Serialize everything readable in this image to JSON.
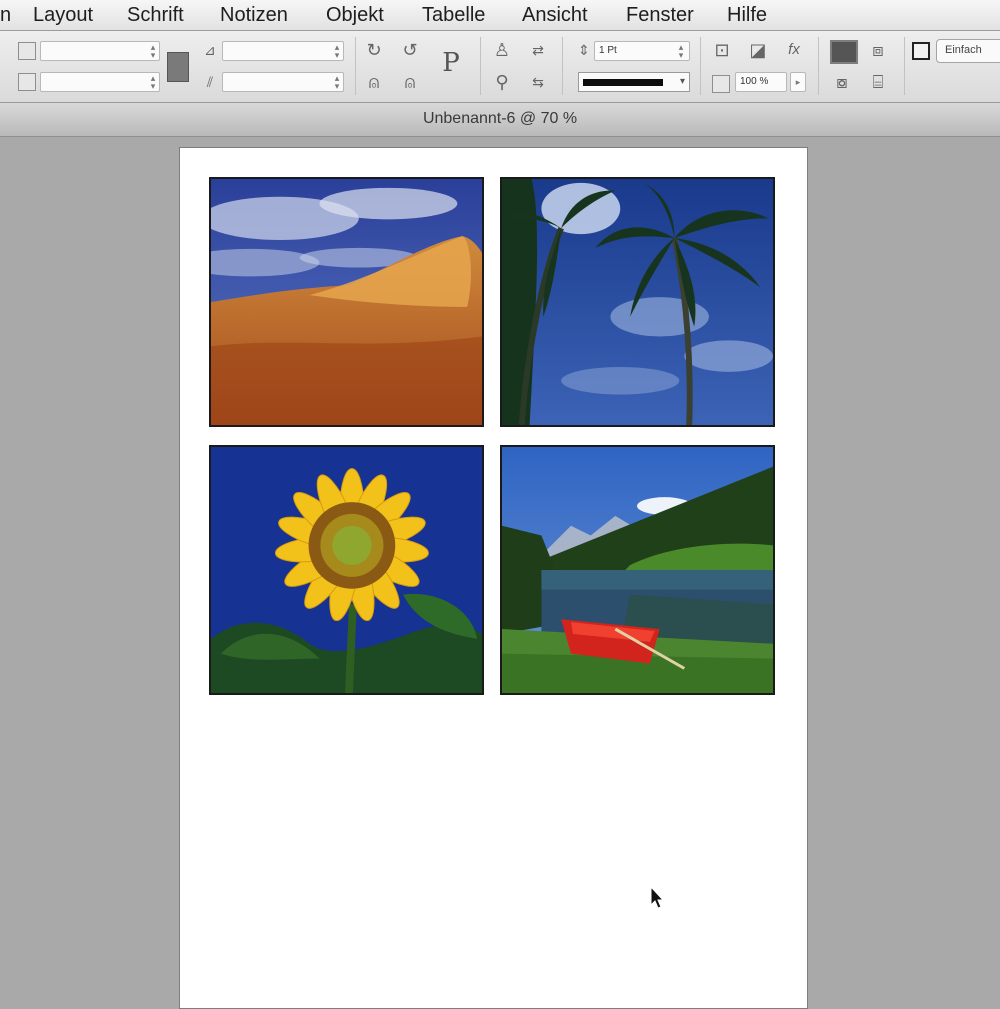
{
  "menu": {
    "items": [
      "n",
      "Layout",
      "Schrift",
      "Notizen",
      "Objekt",
      "Tabelle",
      "Ansicht",
      "Fenster",
      "Hilfe"
    ]
  },
  "control_panel": {
    "stroke_weight": "1 Pt",
    "scale": "100 %",
    "style_label": "Einfach",
    "paragraph_icon_text": "P"
  },
  "document": {
    "title": "Unbenannt-6 @ 70 %"
  },
  "page": {
    "images": [
      {
        "subject": "sand dune under blue sky"
      },
      {
        "subject": "palm trees against blue sky"
      },
      {
        "subject": "sunflower on blue background"
      },
      {
        "subject": "lake with red boat and mountains"
      }
    ]
  },
  "colors": {
    "menubar": "#e8e8e8",
    "pasteboard": "#a9a9a9",
    "page": "#ffffff"
  }
}
